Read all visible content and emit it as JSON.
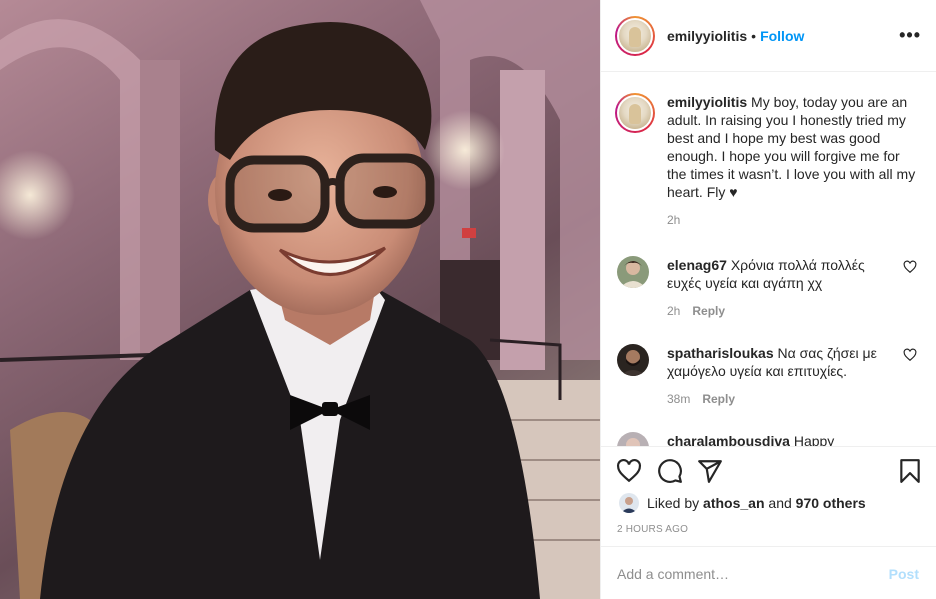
{
  "header": {
    "username": "emilyyiolitis",
    "separator": "•",
    "follow_label": "Follow",
    "more_label": "•••"
  },
  "caption": {
    "username": "emilyyiolitis",
    "text": " My boy, today you are an adult. In raising you I honestly tried my best and I hope my best was good enough. I hope you will forgive me for the times it wasn’t. I love you with all my heart. Fly ♥",
    "time": "2h"
  },
  "comments": [
    {
      "username": "elenag67",
      "text": " Χρόνια πολλά πολλές ευχές υγεία και αγάπη χχ",
      "time": "2h",
      "reply_label": "Reply"
    },
    {
      "username": "spatharisloukas",
      "text": " Να σας ζήσει με χαμόγελο υγεία και επιτυχίες.",
      "time": "38m",
      "reply_label": "Reply"
    },
    {
      "username": "charalambousdiva",
      "text": " Happy",
      "time": "",
      "reply_label": ""
    }
  ],
  "actions": {
    "like_icon": "heart-outline-icon",
    "comment_icon": "comment-bubble-icon",
    "share_icon": "paper-plane-icon",
    "save_icon": "bookmark-icon"
  },
  "likes": {
    "prefix": "Liked by ",
    "user": "athos_an",
    "middle": " and ",
    "count": "970 others"
  },
  "timestamp": "2 HOURS AGO",
  "add_comment": {
    "placeholder": "Add a comment…",
    "post_label": "Post"
  },
  "colors": {
    "accent": "#0095f6",
    "post_disabled": "#b2dffc",
    "muted": "#8e8e8e",
    "text": "#262626",
    "border": "#efefef"
  }
}
